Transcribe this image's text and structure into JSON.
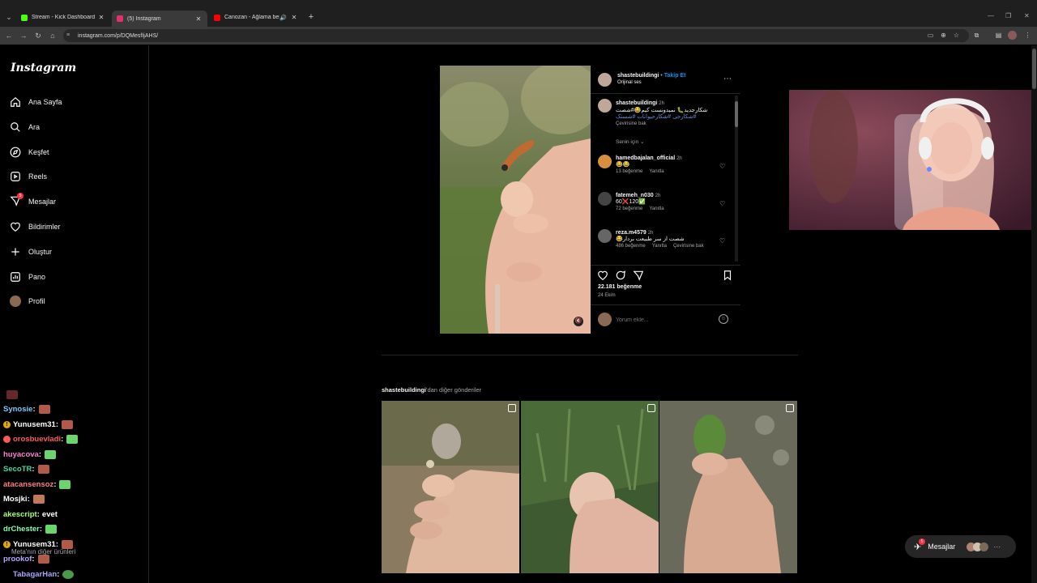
{
  "browser": {
    "tabs": [
      {
        "title": "Stream - Kick Dashboard",
        "favicon_color": "#53fc18"
      },
      {
        "title": "(5) Instagram",
        "favicon_color": "#e1306c"
      },
      {
        "title": "Canozan - Ağlama ben ağla...",
        "favicon_color": "#ff0000"
      }
    ],
    "url": "instagram.com/p/DQMesfIjAHS/"
  },
  "sidebar": {
    "logo": "Instagram",
    "items": [
      {
        "label": "Ana Sayfa",
        "icon": "home-icon"
      },
      {
        "label": "Ara",
        "icon": "search-icon"
      },
      {
        "label": "Keşfet",
        "icon": "compass-icon"
      },
      {
        "label": "Reels",
        "icon": "reels-icon"
      },
      {
        "label": "Mesajlar",
        "icon": "messenger-icon",
        "badge": "5"
      },
      {
        "label": "Bildirimler",
        "icon": "heart-icon"
      },
      {
        "label": "Oluştur",
        "icon": "plus-icon"
      },
      {
        "label": "Pano",
        "icon": "dashboard-icon"
      },
      {
        "label": "Profil",
        "icon": "avatar"
      }
    ],
    "meta_link": "Meta'nın diğer ürünleri"
  },
  "chat": [
    {
      "user": "Synosie",
      "color": "#7cc8ff",
      "text": ""
    },
    {
      "user": "Yunusem31",
      "color": "#ffffff",
      "text": "",
      "badge": true
    },
    {
      "user": "orosbuevladi",
      "color": "#ff5a5a",
      "text": ""
    },
    {
      "user": "huyacova",
      "color": "#ff7fd0",
      "text": ""
    },
    {
      "user": "SecoTR",
      "color": "#43d6a6",
      "text": ""
    },
    {
      "user": "atacansensoz",
      "color": "#ff7f7f",
      "text": ""
    },
    {
      "user": "Mosjki",
      "color": "#ffffff",
      "text": ""
    },
    {
      "user": "akescript",
      "color": "#a6ff6b",
      "text": "evet"
    },
    {
      "user": "drChester",
      "color": "#7fffb0",
      "text": ""
    },
    {
      "user": "Yunusem31",
      "color": "#ffffff",
      "text": "",
      "badge": true
    },
    {
      "user": "prookof",
      "color": "#b7a6ff",
      "text": ""
    },
    {
      "user": "TabagarHan",
      "color": "#a6a6ff",
      "text": ""
    }
  ],
  "post": {
    "author": "shastebuildingi",
    "follow": "Takip Et",
    "audio": "Orijinal ses",
    "caption": {
      "user": "shastebuildingi",
      "time": "2h",
      "text": "شکارجدید🐛 نمیدونست کیم😂#شصت",
      "tags": "#شکارجی #شکارحیوانات #شستک",
      "translate": "Çevirisine bak"
    },
    "filter": "Senin için",
    "comments": [
      {
        "user": "hamedbajalan_official",
        "time": "2h",
        "text": "😂😂",
        "likes": "13 beğenme",
        "reply": "Yanıtla",
        "translate": ""
      },
      {
        "user": "fatemeh_n030",
        "time": "2h",
        "text": "60❌120✅",
        "likes": "72 beğenme",
        "reply": "Yanıtla",
        "translate": ""
      },
      {
        "user": "reza.m4579",
        "time": "2h",
        "text": "شصت از سر طبیعت بردار😂",
        "likes": "486 beğenme",
        "reply": "Yanıtla",
        "translate": "Çevirisine bak"
      }
    ],
    "likes": "22.181 beğenme",
    "date": "24 Ekim",
    "comment_placeholder": "Yorum ekle..."
  },
  "more": {
    "user": "shastebuildingi",
    "suffix": "'dan diğer gönderiler"
  },
  "messages_bar": {
    "label": "Mesajlar",
    "badge": "5"
  }
}
